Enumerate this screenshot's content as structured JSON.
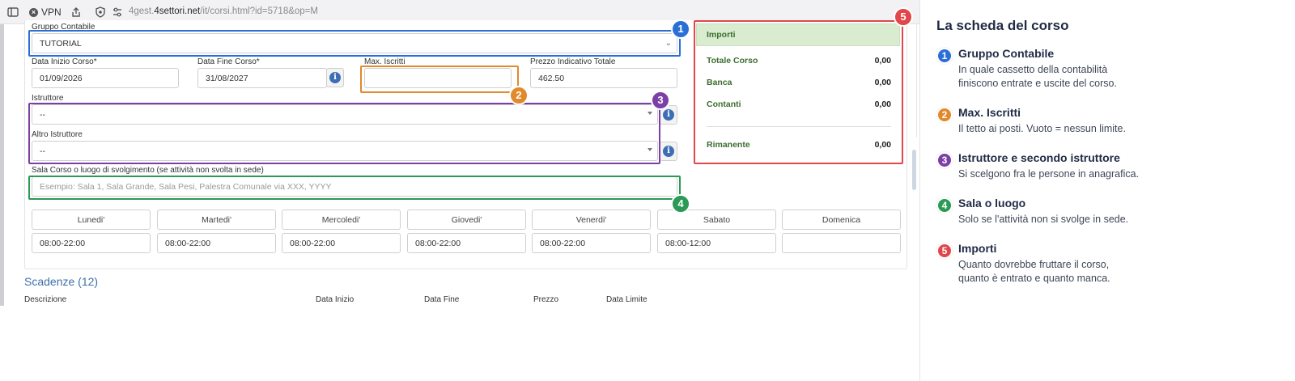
{
  "browser": {
    "vpn_label": "VPN",
    "url_prefix": "4gest.",
    "url_domain": "4settori.net",
    "url_path": "/it/corsi.html?id=5718&op=M"
  },
  "form": {
    "gruppo_contabile": {
      "label": "Gruppo Contabile",
      "value": "TUTORIAL"
    },
    "data_inizio": {
      "label": "Data Inizio Corso*",
      "value": "01/09/2026"
    },
    "data_fine": {
      "label": "Data Fine Corso*",
      "value": "31/08/2027"
    },
    "max_iscritti": {
      "label": "Max. Iscritti",
      "value": ""
    },
    "prezzo": {
      "label": "Prezzo Indicativo Totale",
      "value": "462.50"
    },
    "istruttore": {
      "label": "Istruttore",
      "value": "--"
    },
    "altro_istruttore": {
      "label": "Altro Istruttore",
      "value": "--"
    },
    "sala": {
      "label": "Sala Corso o luogo di svolgimento (se attività non svolta in sede)",
      "placeholder": "Esempio: Sala 1, Sala Grande, Sala Pesi, Palestra Comunale via XXX, YYYY"
    },
    "days": [
      {
        "name": "Lunedi'",
        "hours": "08:00-22:00"
      },
      {
        "name": "Martedi'",
        "hours": "08:00-22:00"
      },
      {
        "name": "Mercoledi'",
        "hours": "08:00-22:00"
      },
      {
        "name": "Giovedi'",
        "hours": "08:00-22:00"
      },
      {
        "name": "Venerdi'",
        "hours": "08:00-22:00"
      },
      {
        "name": "Sabato",
        "hours": "08:00-12:00"
      },
      {
        "name": "Domenica",
        "hours": ""
      }
    ]
  },
  "importi": {
    "title": "Importi",
    "rows": [
      {
        "label": "Totale Corso",
        "value": "0,00"
      },
      {
        "label": "Banca",
        "value": "0,00"
      },
      {
        "label": "Contanti",
        "value": "0,00"
      },
      {
        "label": "Rimanente",
        "value": "0,00"
      }
    ]
  },
  "scadenze": {
    "title": "Scadenze (12)",
    "columns": [
      "Descrizione",
      "Data Inizio",
      "Data Fine",
      "Prezzo",
      "Data Limite"
    ]
  },
  "badges": [
    "1",
    "2",
    "3",
    "4",
    "5"
  ],
  "colors": {
    "blue": "#2b6fd6",
    "orange": "#e08a2c",
    "purple": "#7b3fa6",
    "green": "#2a9a55",
    "red": "#e0464a"
  },
  "side": {
    "title": "La scheda del corso",
    "items": [
      {
        "num": "1",
        "title": "Gruppo Contabile",
        "desc_1": "In quale cassetto della contabilità",
        "desc_2": "finiscono entrate e uscite del corso."
      },
      {
        "num": "2",
        "title": "Max. Iscritti",
        "desc_1": "Il tetto ai posti. Vuoto = nessun limite.",
        "desc_2": ""
      },
      {
        "num": "3",
        "title": "Istruttore e secondo istruttore",
        "desc_1": "Si scelgono fra le persone in anagrafica.",
        "desc_2": ""
      },
      {
        "num": "4",
        "title": "Sala o luogo",
        "desc_1": "Solo se l'attività non si svolge in sede.",
        "desc_2": ""
      },
      {
        "num": "5",
        "title": "Importi",
        "desc_1": "Quanto dovrebbe fruttare il corso,",
        "desc_2": "quanto è entrato e quanto manca."
      }
    ]
  }
}
